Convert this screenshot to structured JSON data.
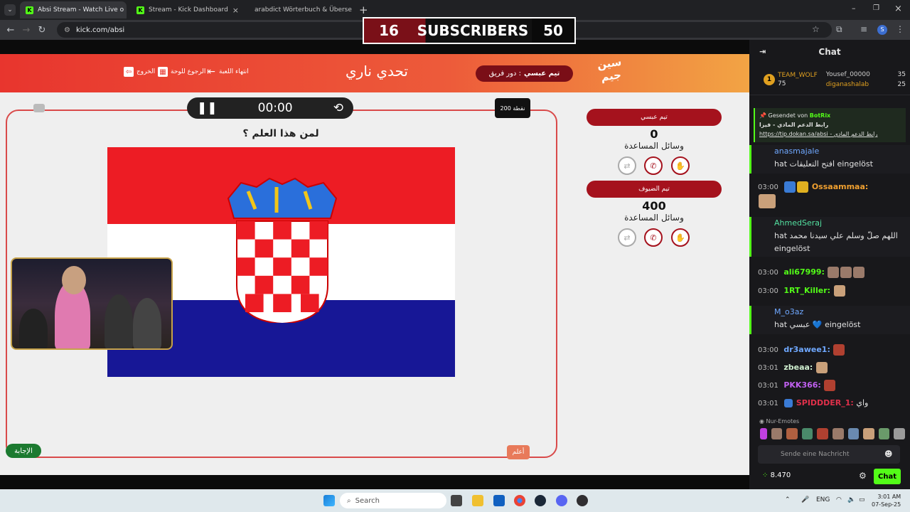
{
  "browser": {
    "tabs": [
      {
        "label": "Absi Stream - Watch Live o",
        "active": true
      },
      {
        "label": "Stream - Kick Dashboard",
        "active": false
      },
      {
        "label": "arabdict Wörterbuch & Überse",
        "active": false
      }
    ],
    "url": "kick.com/absi"
  },
  "sub_banner": {
    "current": "16",
    "label": "SUBSCRIBERS",
    "goal": "50"
  },
  "game": {
    "exit": "الخروج",
    "back_to_board": "الرجوع للوحة",
    "end_game": "انتهاء اللعبة",
    "title": "تحدي ناري",
    "turn_label": "دور فريق :",
    "turn_team": "تيم عبسي",
    "logo": "سين جيم",
    "timer": "00:00",
    "points": "200 نقطة",
    "question": "لمن هذا العلم ؟",
    "answer_button": "الإجابة",
    "know_button": "أعلم",
    "teams": [
      {
        "name": "تيم عبسي",
        "score": "0",
        "aids_label": "وسائل المساعدة"
      },
      {
        "name": "تيم الضيوف",
        "score": "400",
        "aids_label": "وسائل المساعدة"
      }
    ]
  },
  "chat": {
    "title": "Chat",
    "leaders": {
      "rank": "1",
      "team": "TEAM_WOLF",
      "team_count": "75",
      "user1": "Yousef_00000",
      "user1_count": "35",
      "user2": "diganashalab",
      "user2_count": "25"
    },
    "pinned": {
      "sent_by": "Gesendet von",
      "bot": "BotRix",
      "text": "رابط الدعم المادي - فيزا",
      "link": "https://tip.dokan.sa/absi - رابط الدعم المادي"
    },
    "messages": [
      {
        "user": "anasmajale",
        "text": "hat افتح التعليقات eingelöst"
      },
      {
        "time": "03:00",
        "user": "Ossaammaa:",
        "text": ""
      },
      {
        "user": "AhmedSeraj",
        "text": "hat اللهم صلّ وسلم علي سيدنا محمد eingelöst"
      },
      {
        "time": "03:00",
        "user": "ali67999:",
        "text": ""
      },
      {
        "time": "03:00",
        "user": "1RT_Killer:",
        "text": ""
      },
      {
        "user": "M_o3az",
        "text": "hat عبسي 💙 eingelöst"
      },
      {
        "time": "03:00",
        "user": "dr3awee1:",
        "text": ""
      },
      {
        "time": "03:01",
        "user": "zbeaa:",
        "text": ""
      },
      {
        "time": "03:01",
        "user": "PKK366:",
        "text": ""
      },
      {
        "time": "03:01",
        "user": "SPIDDDER_1:",
        "text": "واي"
      }
    ],
    "emote_only": "Nur-Emotes",
    "input_placeholder": "Sende eine Nachricht",
    "balance": "8.470",
    "send_button": "Chat"
  },
  "taskbar": {
    "search": "Search",
    "lang": "ENG",
    "time": "3:01 AM",
    "date": "07-Sep-25"
  }
}
